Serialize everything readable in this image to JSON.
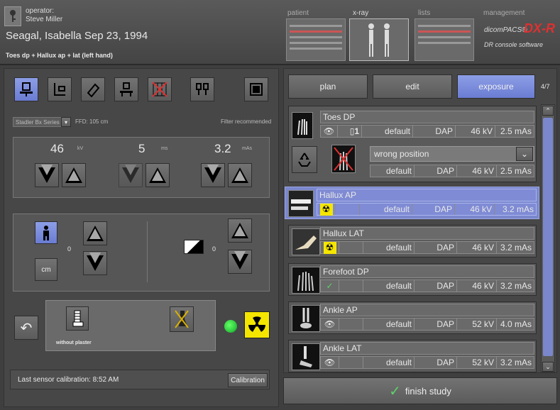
{
  "header": {
    "operator_label": "operator:",
    "operator_name": "Steve Miller",
    "patient": "Seagal,  Isabella  Sep 23, 1994",
    "study": "Toes dp + Hallux ap + lat (left hand)",
    "nav": [
      "patient",
      "x-ray",
      "lists",
      "management"
    ],
    "brand_top": "dicomPACS®",
    "brand_mark": "DX-R",
    "brand_sub": "DR console software"
  },
  "settings": {
    "series_select": "Stadler Bx Series",
    "ffd": "FFD: 105 cm",
    "filter": "Filter recommended",
    "kv_value": "46",
    "kv_unit": "kV",
    "ms_value": "5",
    "ms_unit": "ms",
    "mas_value": "3.2",
    "mas_unit": "mAs",
    "patient_size_value": "0",
    "cm_label": "cm",
    "density_value": "0",
    "without_plaster": "without plaster",
    "calibration_text": "Last sensor calibration: 8:52 AM",
    "calibration_button": "Calibration"
  },
  "tabs": {
    "plan": "plan",
    "edit": "edit",
    "exposure": "exposure",
    "counter": "4/7"
  },
  "exposures": [
    {
      "title": "Toes DP",
      "count": "1",
      "preset": "default",
      "dap": "DAP",
      "kv": "46 kV",
      "mas": "2.5 mAs",
      "sub_select": "wrong position",
      "sub_preset": "default",
      "sub_dap": "DAP",
      "sub_kv": "46 kV",
      "sub_mas": "2.5 mAs"
    },
    {
      "title": "Hallux AP",
      "preset": "default",
      "dap": "DAP",
      "kv": "46 kV",
      "mas": "3.2 mAs"
    },
    {
      "title": "Hallux LAT",
      "preset": "default",
      "dap": "DAP",
      "kv": "46 kV",
      "mas": "3.2 mAs"
    },
    {
      "title": "Forefoot DP",
      "preset": "default",
      "dap": "DAP",
      "kv": "46 kV",
      "mas": "3.2 mAs"
    },
    {
      "title": "Ankle AP",
      "preset": "default",
      "dap": "DAP",
      "kv": "52 kV",
      "mas": "4.0 mAs"
    },
    {
      "title": "Ankle LAT",
      "preset": "default",
      "dap": "DAP",
      "kv": "52 kV",
      "mas": "3.2 mAs"
    }
  ],
  "finish": "finish study",
  "colors": {
    "accent": "#6a7cd2",
    "selected": "#7a87cc",
    "radiation": "#f5e600",
    "brand_red": "#e03030",
    "ready_green": "#2ecc40"
  }
}
